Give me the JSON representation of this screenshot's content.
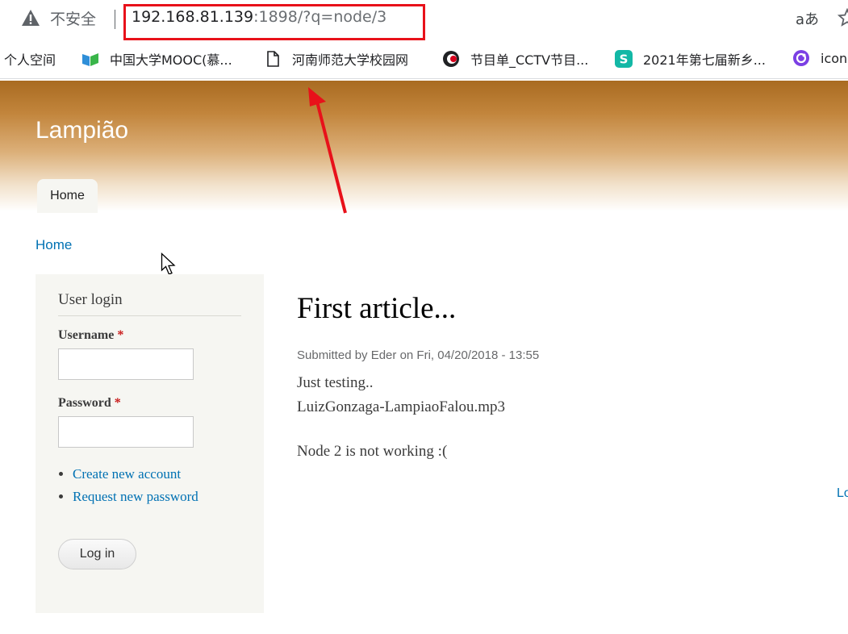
{
  "browser": {
    "security_label": "不安全",
    "url_host": "192.168.81.139",
    "url_rest": ":1898/?q=node/3",
    "read_aloud": "aあ"
  },
  "bookmarks": [
    {
      "label": "个人空间",
      "icon": "none"
    },
    {
      "label": "中国大学MOOC(慕...",
      "icon": "mooc-icon"
    },
    {
      "label": "河南师范大学校园网",
      "icon": "document-icon"
    },
    {
      "label": "节目单_CCTV节目...",
      "icon": "cctv-icon"
    },
    {
      "label": "2021年第七届新乡...",
      "icon": "s-app-icon"
    },
    {
      "label": "icon",
      "icon": "icon-site-icon"
    }
  ],
  "site": {
    "name": "Lampião",
    "tab_home": "Home",
    "breadcrumb": "Home"
  },
  "login_block": {
    "title": "User login",
    "username_label": "Username",
    "password_label": "Password",
    "required_mark": "*",
    "username_value": "",
    "password_value": "",
    "links": [
      "Create new account",
      "Request new password"
    ],
    "login_button": "Log in"
  },
  "article": {
    "title": "First article...",
    "submitted": "Submitted by Eder on Fri, 04/20/2018 - 13:55",
    "lines": [
      "Just testing..",
      "LuizGonzaga-LampiaoFalou.mp3",
      "Node 2 is not working :("
    ]
  },
  "edge_link": "Lo",
  "colors": {
    "link": "#0071b3",
    "annotation": "#e8111a",
    "header_top": "#a96b21"
  }
}
